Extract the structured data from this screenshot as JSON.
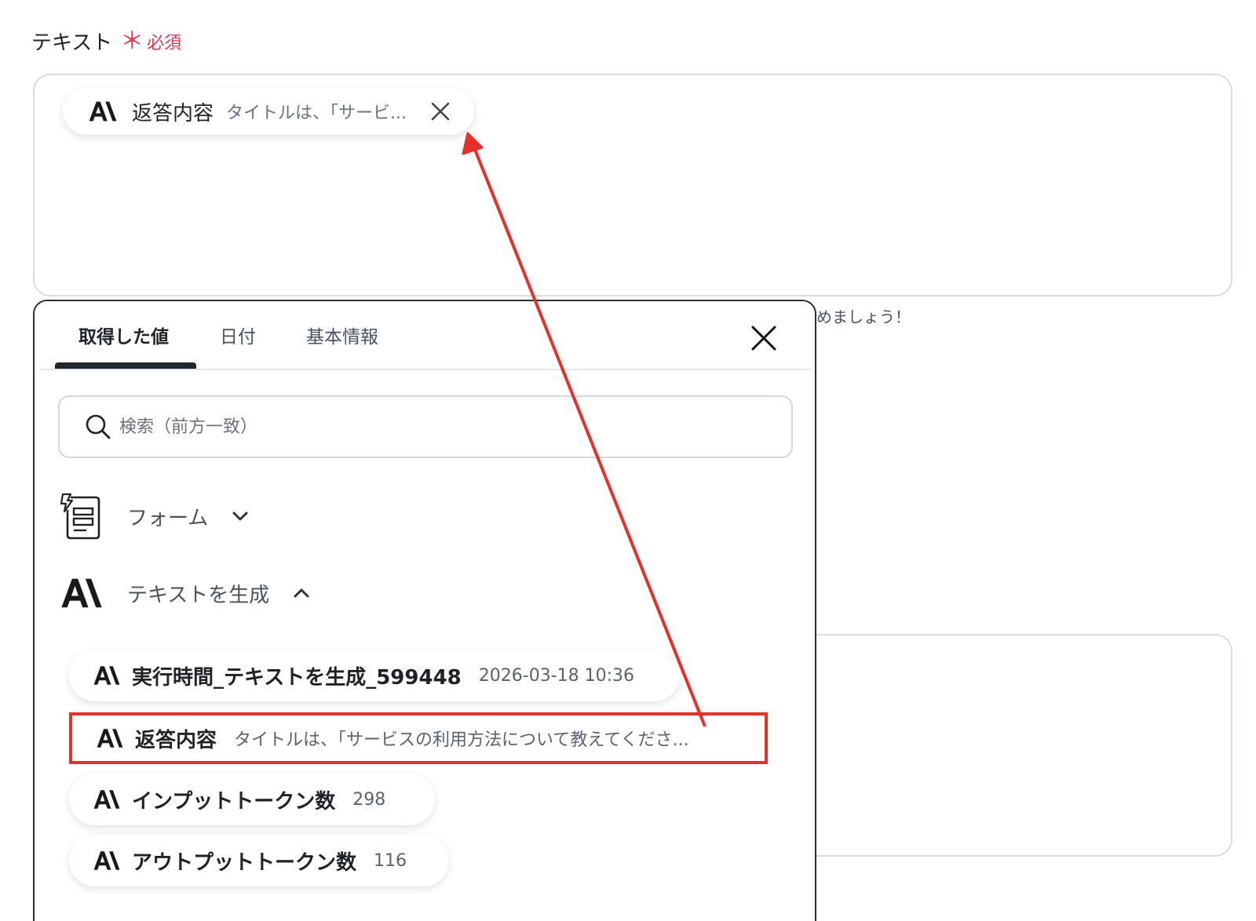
{
  "field": {
    "label": "テキスト",
    "required_mark": "＊",
    "required_text": "必須",
    "hint_fragment": "めましょう！"
  },
  "selected_chip": {
    "label": "返答内容",
    "value": "タイトルは、「サービ..."
  },
  "picker": {
    "tabs": [
      {
        "label": "取得した値"
      },
      {
        "label": "日付"
      },
      {
        "label": "基本情報"
      }
    ],
    "search_placeholder": "検索（前方一致）",
    "groups": [
      {
        "title": "フォーム",
        "icon": "form-icon",
        "expanded": false
      },
      {
        "title": "テキストを生成",
        "icon": "anthropic-ai-icon",
        "expanded": true
      }
    ],
    "items": [
      {
        "label": "実行時間_テキストを生成_599448",
        "value": "2026-03-18 10:36"
      },
      {
        "label": "返答内容",
        "value": "タイトルは、「サービスの利用方法について教えてくださ..."
      },
      {
        "label": "インプットトークン数",
        "value": "298"
      },
      {
        "label": "アウトプットトークン数",
        "value": "116"
      }
    ]
  },
  "colors": {
    "required": "#e8334d",
    "highlight": "#e8302a",
    "text": "#1f2328",
    "muted": "#4a5260"
  }
}
